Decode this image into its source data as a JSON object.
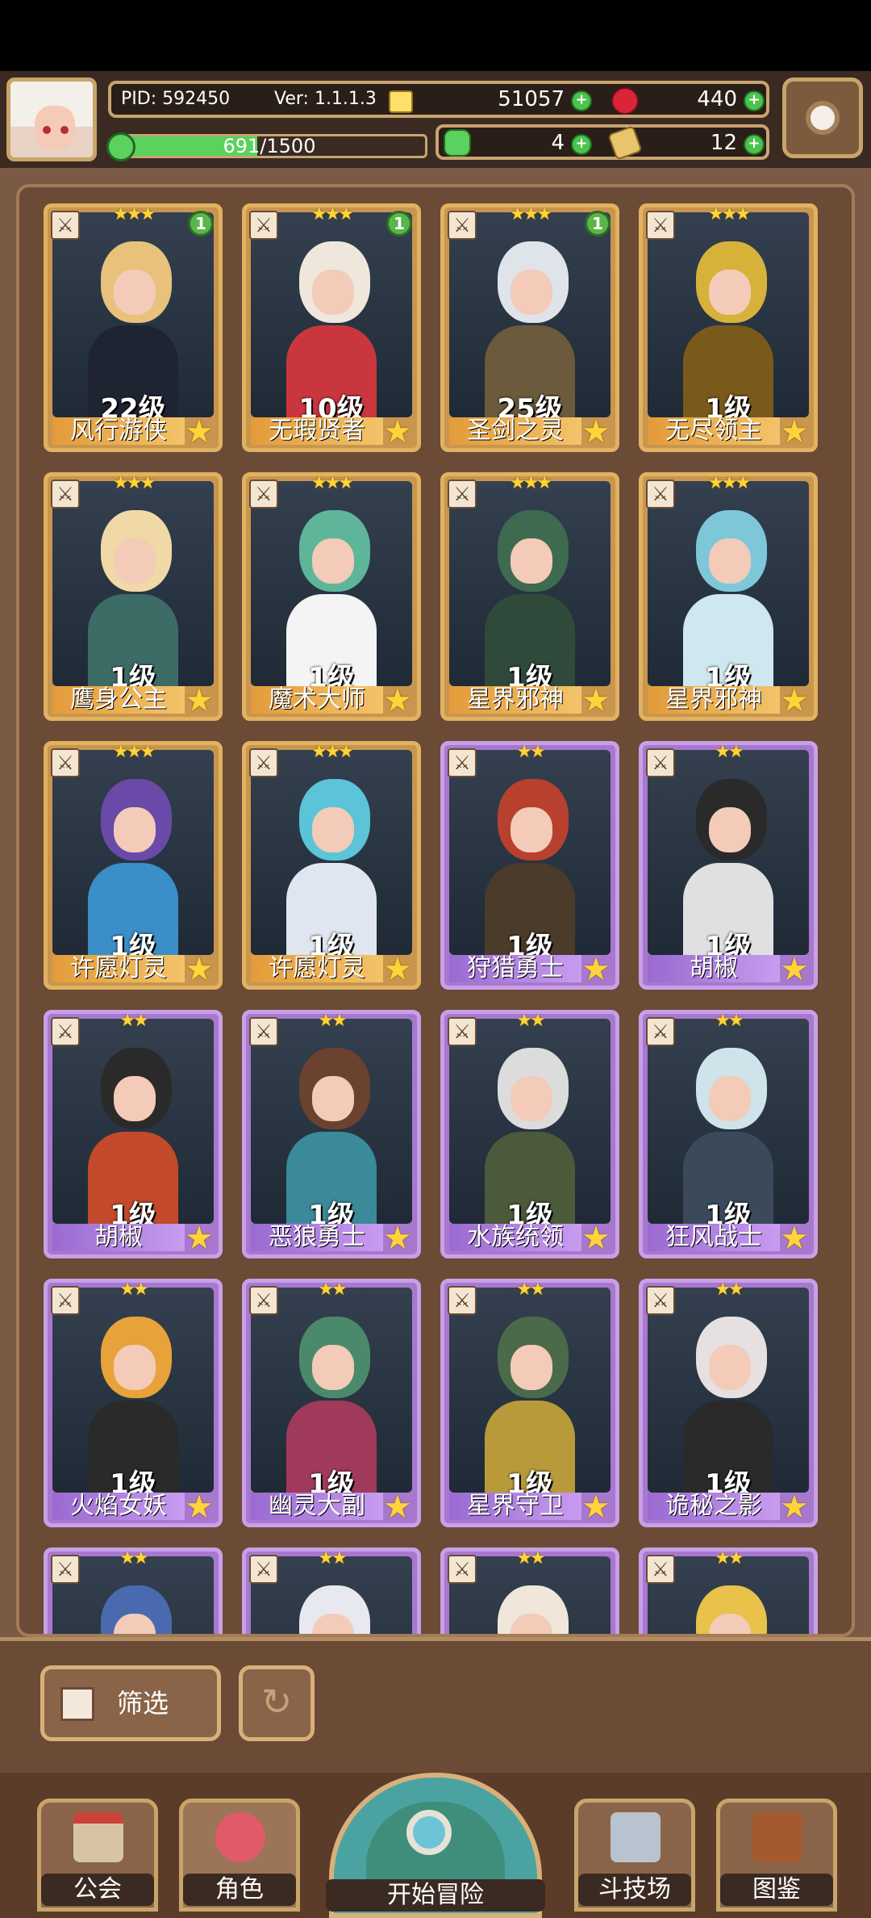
{
  "hud": {
    "pid": "PID: 592450",
    "version": "Ver: 1.1.1.3",
    "gold": "51057",
    "gems": "440",
    "xp_text": "691/1500",
    "xp_fraction": 0.46,
    "clover": "4",
    "scroll": "12"
  },
  "cards": [
    {
      "level": "22级",
      "name": "风行游侠",
      "stars": "★★★",
      "badge": "1",
      "rarity": "gold"
    },
    {
      "level": "10级",
      "name": "无瑕贤者",
      "stars": "★★★",
      "badge": "1",
      "rarity": "gold"
    },
    {
      "level": "25级",
      "name": "圣剑之灵",
      "stars": "★★★",
      "badge": "1",
      "rarity": "gold"
    },
    {
      "level": "1级",
      "name": "无尽领主",
      "stars": "★★★",
      "badge": "",
      "rarity": "gold"
    },
    {
      "level": "1级",
      "name": "鹰身公主",
      "stars": "★★★",
      "badge": "",
      "rarity": "gold"
    },
    {
      "level": "1级",
      "name": "魔术大师",
      "stars": "★★★",
      "badge": "",
      "rarity": "gold"
    },
    {
      "level": "1级",
      "name": "星界邪神",
      "stars": "★★★",
      "badge": "",
      "rarity": "gold"
    },
    {
      "level": "1级",
      "name": "星界邪神",
      "stars": "★★★",
      "badge": "",
      "rarity": "gold"
    },
    {
      "level": "1级",
      "name": "许愿灯灵",
      "stars": "★★★",
      "badge": "",
      "rarity": "gold"
    },
    {
      "level": "1级",
      "name": "许愿灯灵",
      "stars": "★★★",
      "badge": "",
      "rarity": "gold"
    },
    {
      "level": "1级",
      "name": "狩猎勇士",
      "stars": "★★",
      "badge": "",
      "rarity": "purple"
    },
    {
      "level": "1级",
      "name": "胡椒",
      "stars": "★★",
      "badge": "",
      "rarity": "purple"
    },
    {
      "level": "1级",
      "name": "胡椒",
      "stars": "★★",
      "badge": "",
      "rarity": "purple"
    },
    {
      "level": "1级",
      "name": "恶狼勇士",
      "stars": "★★",
      "badge": "",
      "rarity": "purple"
    },
    {
      "level": "1级",
      "name": "水族统领",
      "stars": "★★",
      "badge": "",
      "rarity": "purple"
    },
    {
      "level": "1级",
      "name": "狂风战士",
      "stars": "★★",
      "badge": "",
      "rarity": "purple"
    },
    {
      "level": "1级",
      "name": "火焰女妖",
      "stars": "★★",
      "badge": "",
      "rarity": "purple"
    },
    {
      "level": "1级",
      "name": "幽灵大副",
      "stars": "★★",
      "badge": "",
      "rarity": "purple"
    },
    {
      "level": "1级",
      "name": "星界守卫",
      "stars": "★★",
      "badge": "",
      "rarity": "purple"
    },
    {
      "level": "1级",
      "name": "诡秘之影",
      "stars": "★★",
      "badge": "",
      "rarity": "purple"
    },
    {
      "level": "",
      "name": "",
      "stars": "★★",
      "badge": "",
      "rarity": "purple"
    },
    {
      "level": "",
      "name": "",
      "stars": "★★",
      "badge": "",
      "rarity": "purple"
    },
    {
      "level": "",
      "name": "",
      "stars": "★★",
      "badge": "",
      "rarity": "purple"
    },
    {
      "level": "",
      "name": "",
      "stars": "★★",
      "badge": "",
      "rarity": "purple"
    }
  ],
  "filter": {
    "label": "筛选"
  },
  "nav": {
    "guild": "公会",
    "character": "角色",
    "start": "开始冒险",
    "arena": "斗技场",
    "codex": "图鉴"
  }
}
